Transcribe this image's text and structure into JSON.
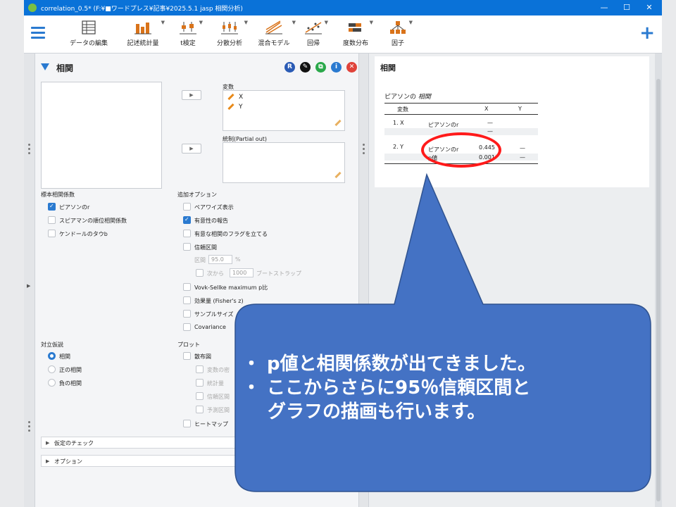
{
  "window": {
    "title": "correlation_0.5*   (F:¥■ワードプレス¥記事¥2025.5.1  jasp  相関分析)",
    "controls": [
      "—",
      "☐",
      "✕"
    ]
  },
  "toolbar": {
    "items": [
      {
        "label": "データの編集"
      },
      {
        "label": "記述統計量"
      },
      {
        "label": "t検定"
      },
      {
        "label": "分散分析"
      },
      {
        "label": "混合モデル"
      },
      {
        "label": "回帰"
      },
      {
        "label": "度数分布"
      },
      {
        "label": "因子"
      }
    ],
    "plus": "+"
  },
  "analysis": {
    "title": "相関",
    "header_icons": [
      "R",
      "✎",
      "⧉",
      "i",
      "✕"
    ],
    "variables_label": "変数",
    "variables": [
      "X",
      "Y"
    ],
    "partial_label": "統制(Partial out)",
    "sample_label": "標本相関係数",
    "sample_options": [
      {
        "label": "ピアソンのr",
        "checked": true
      },
      {
        "label": "スピアマンの順位相関係数",
        "checked": false
      },
      {
        "label": "ケンドールのタウb",
        "checked": false
      }
    ],
    "extra_label": "追加オプション",
    "extra_options": [
      {
        "label": "ペアワイズ表示",
        "checked": false
      },
      {
        "label": "有意性の報告",
        "checked": true
      },
      {
        "label": "有意な相関のフラグを立てる",
        "checked": false
      },
      {
        "label": "信頼区間",
        "checked": false
      }
    ],
    "interval_label": "区間",
    "interval_value": "95.0",
    "interval_unit": "%",
    "from_label": "次から",
    "bootstrap_value": "1000",
    "bootstrap_label": "ブートストラップ",
    "extra_options2": [
      {
        "label": "Vovk-Sellke maximum p比",
        "checked": false
      },
      {
        "label": "効果量 (Fisher's z)",
        "checked": false
      },
      {
        "label": "サンプルサイズ",
        "checked": false
      },
      {
        "label": "Covariance",
        "checked": false
      }
    ],
    "alt_label": "対立仮説",
    "alt_options": [
      {
        "label": "相関",
        "checked": true
      },
      {
        "label": "正の相関",
        "checked": false
      },
      {
        "label": "負の相関",
        "checked": false
      }
    ],
    "plot_label": "プロット",
    "plot_main": "散布図",
    "plot_subs": [
      "変数の密",
      "統計量",
      "信頼区間",
      "予測区間"
    ],
    "heatmap": "ヒートマップ",
    "sections": [
      "仮定のチェック",
      "オプション"
    ]
  },
  "results": {
    "title": "相関",
    "caption_prefix": "ピアソンの",
    "caption_italic": "相関",
    "headers": [
      "変数",
      "X",
      "Y"
    ],
    "rows": [
      {
        "var": "1. X",
        "stat": "ピアソンのr",
        "x": "—",
        "y": ""
      },
      {
        "var": "",
        "stat": "",
        "x": "—",
        "y": ""
      },
      {
        "var": "2. Y",
        "stat": "ピアソンのr",
        "x": "0.445",
        "y": "—"
      },
      {
        "var": "",
        "stat": "p値",
        "x": "0.001",
        "y": "—"
      }
    ]
  },
  "callout": {
    "line1": "・ p値と相関係数が出てきました。",
    "line2": "・ ここからさらに95％信頼区間と",
    "line3": "グラフの描画も行います。",
    "fill": "#4472c4"
  }
}
